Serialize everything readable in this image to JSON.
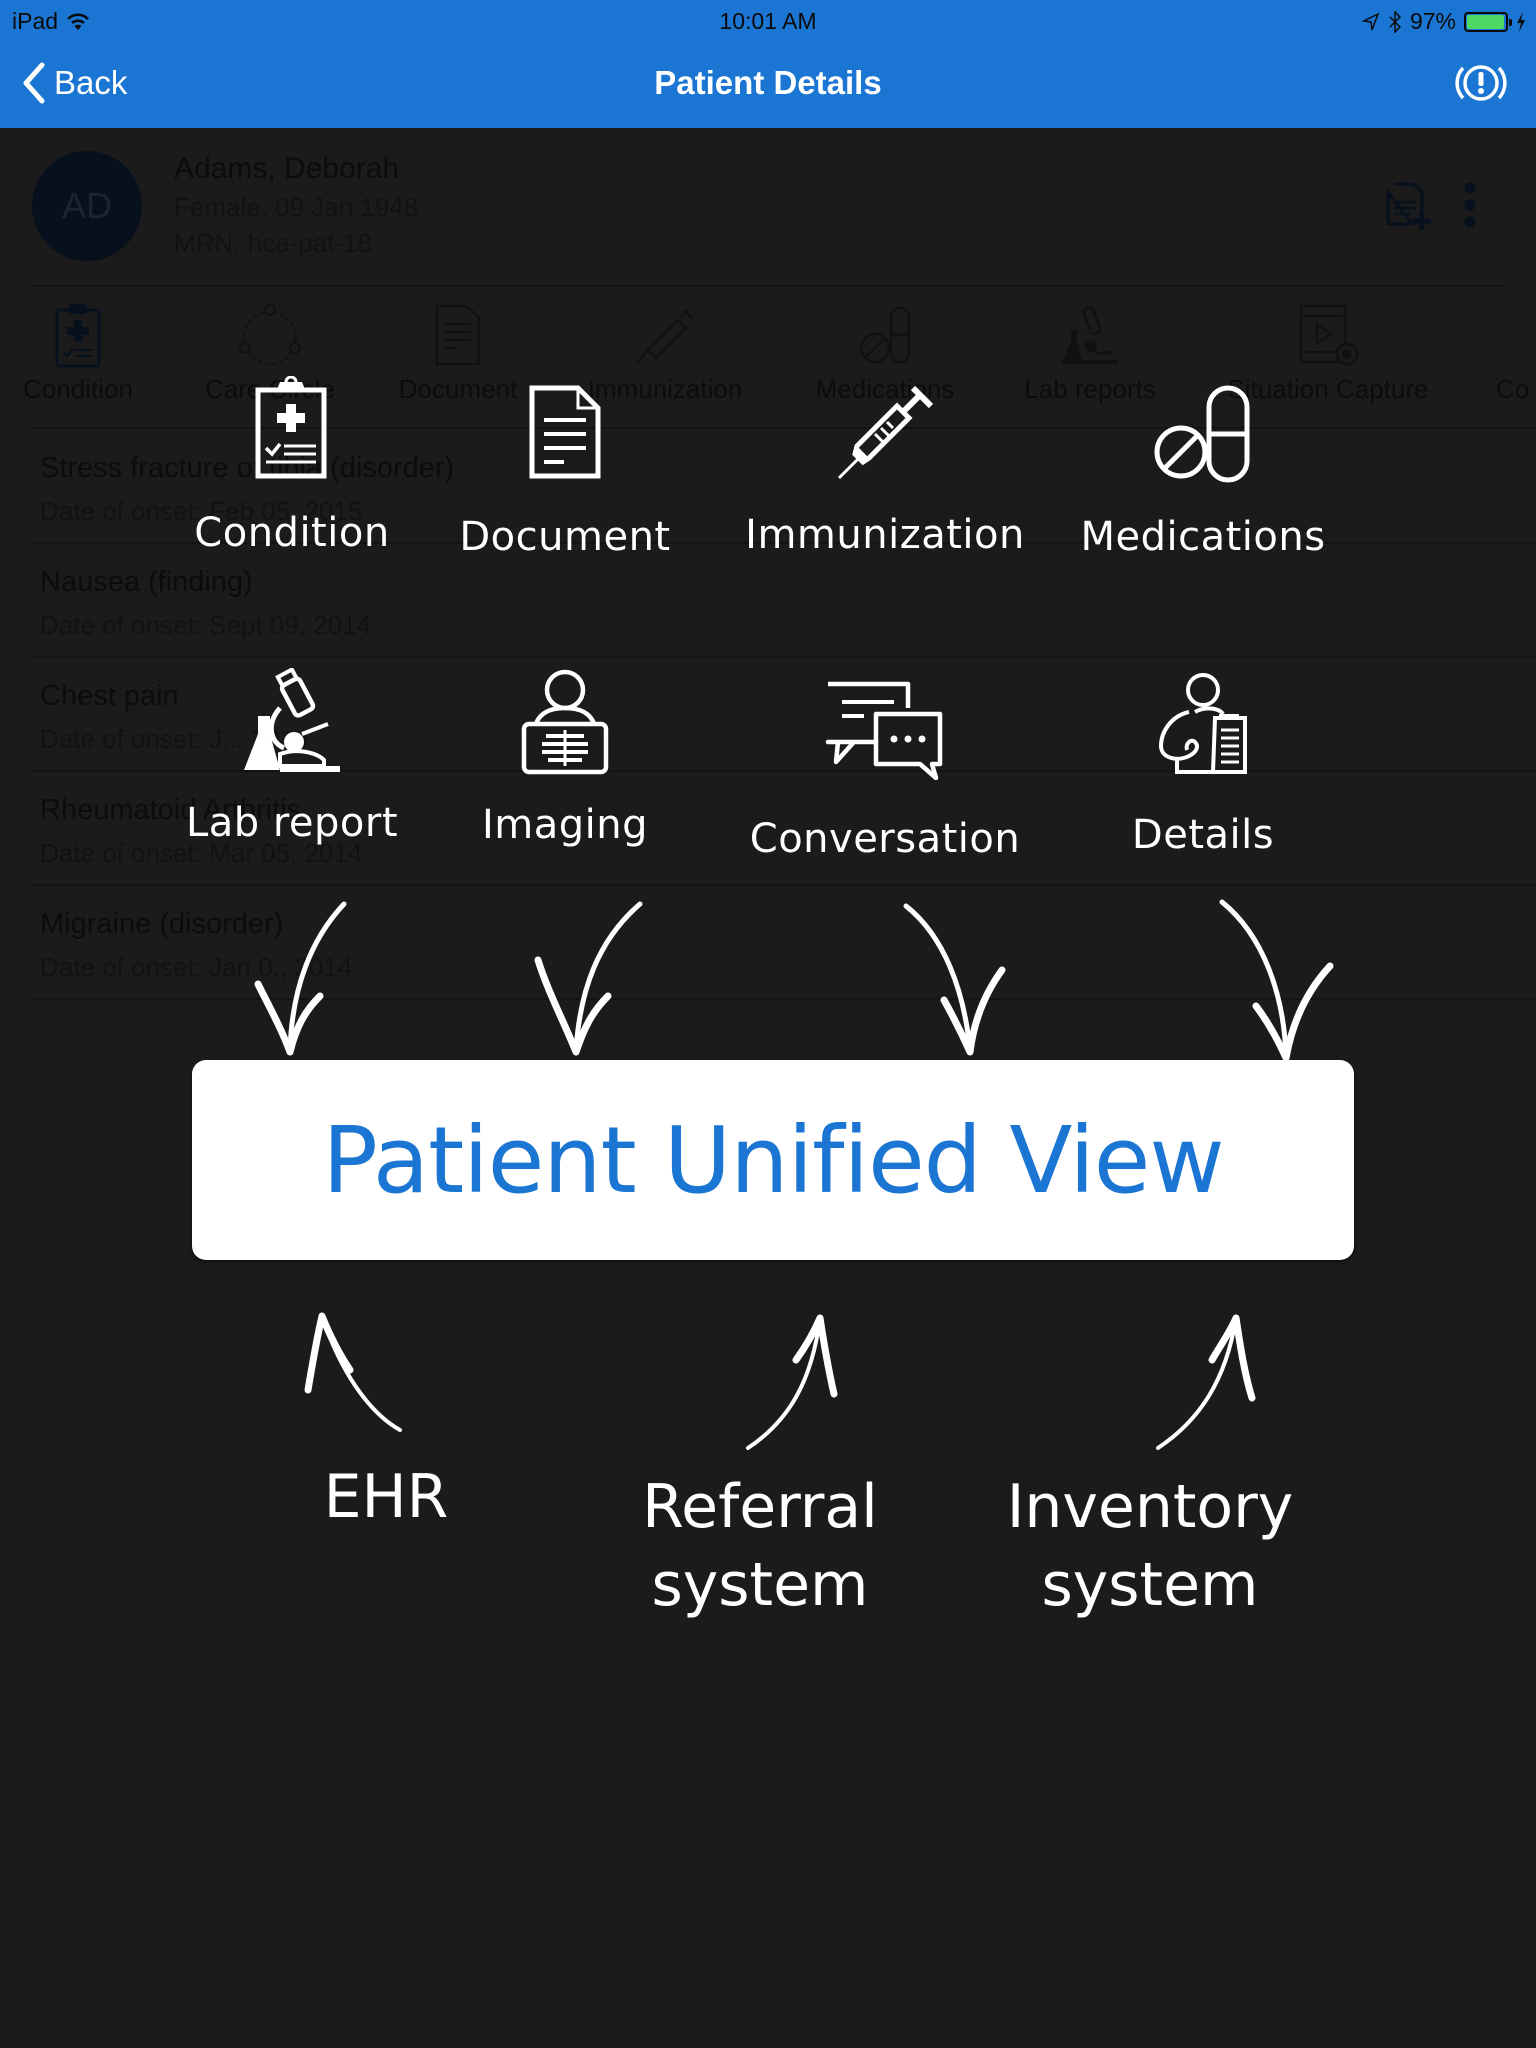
{
  "status_bar": {
    "device": "iPad",
    "time": "10:01 AM",
    "battery_percent_label": "97%",
    "battery_level": 0.97
  },
  "nav": {
    "back_label": "Back",
    "title": "Patient Details",
    "alert_icon": "alert-circle-icon"
  },
  "patient": {
    "initials": "AD",
    "name": "Adams, Deborah",
    "gender_dob": "Female, 09 Jan 1948",
    "mrn": "MRN: hca-pat-18"
  },
  "tabs": [
    {
      "label": "Condition",
      "icon": "clipboard-medical-icon"
    },
    {
      "label": "Care Circle",
      "icon": "care-circle-icon"
    },
    {
      "label": "Document",
      "icon": "document-icon"
    },
    {
      "label": "Immunization",
      "icon": "syringe-icon"
    },
    {
      "label": "Medications",
      "icon": "pills-icon"
    },
    {
      "label": "Lab reports",
      "icon": "microscope-icon"
    },
    {
      "label": "Situation Capture",
      "icon": "video-capture-icon"
    },
    {
      "label": "Co",
      "icon": ""
    }
  ],
  "conditions": [
    {
      "title": "Stress fracture of tibia (disorder)",
      "date": "Date of onset: Feb 05, 2015"
    },
    {
      "title": "Nausea (finding)",
      "date": "Date of onset: Sept 09, 2014"
    },
    {
      "title": "Chest pain",
      "date": "Date of onset: J... 2014"
    },
    {
      "title": "Rheumatoid Arthritis",
      "date": "Date of onset: Mar 05, 2014"
    },
    {
      "title": "Migraine (disorder)",
      "date": "Date of onset: Jan 0., 2014"
    }
  ],
  "overlay": {
    "features": [
      {
        "label": "Condition",
        "icon": "clipboard-medical-icon"
      },
      {
        "label": "Document",
        "icon": "document-icon"
      },
      {
        "label": "Immunization",
        "icon": "syringe-icon"
      },
      {
        "label": "Medications",
        "icon": "pills-icon"
      },
      {
        "label": "Lab report",
        "icon": "microscope-icon"
      },
      {
        "label": "Imaging",
        "icon": "xray-icon"
      },
      {
        "label": "Conversation",
        "icon": "chat-bubbles-icon"
      },
      {
        "label": "Details",
        "icon": "patient-details-icon"
      }
    ],
    "center_title": "Patient Unified View",
    "sources": [
      {
        "line1": "EHR",
        "line2": ""
      },
      {
        "line1": "Referral",
        "line2": "system"
      },
      {
        "line1": "Inventory",
        "line2": "system"
      }
    ]
  },
  "colors": {
    "brand_blue": "#1b76d3",
    "overlay_bg": "#1b1b1b",
    "battery_green": "#4cd964"
  }
}
